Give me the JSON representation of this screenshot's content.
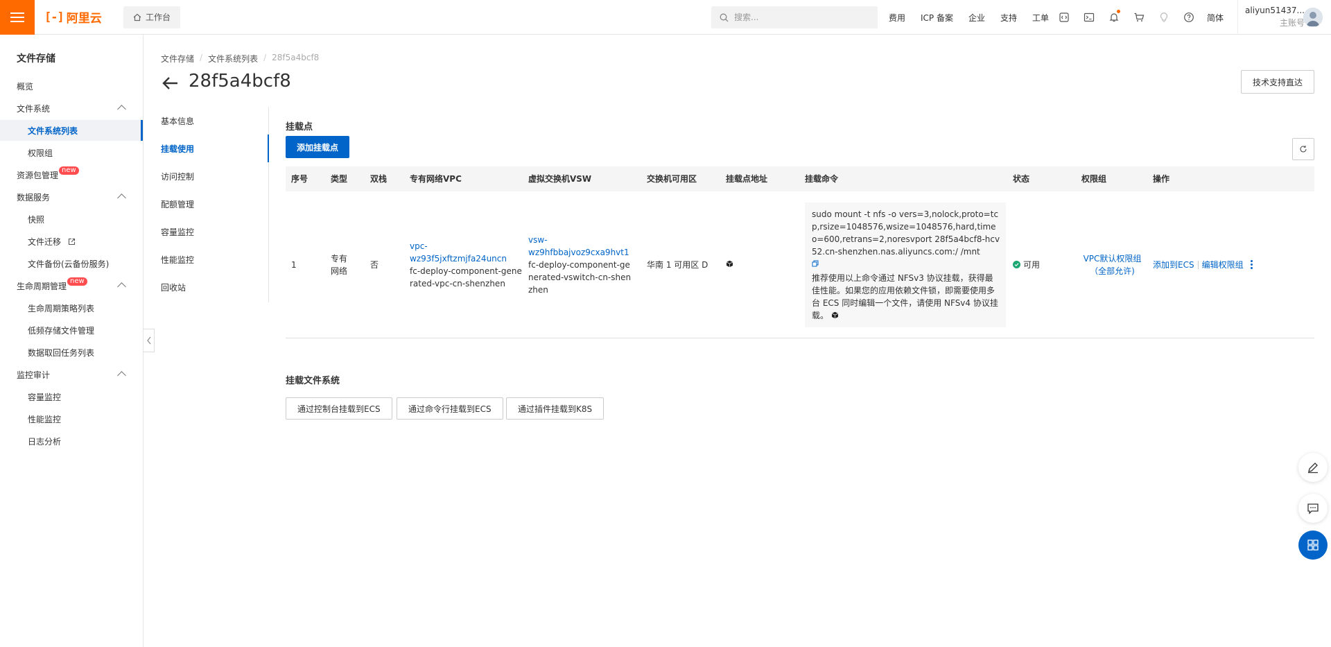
{
  "topbar": {
    "logo_text": "阿里云",
    "logo_mark": "[-]",
    "workbench": "工作台",
    "search_placeholder": "搜索...",
    "links": [
      "费用",
      "ICP 备案",
      "企业",
      "支持",
      "工单"
    ],
    "icons": [
      "code-icon",
      "terminal-icon",
      "bell-icon",
      "cart-icon",
      "lightbulb-icon",
      "help-icon"
    ],
    "language": "简体",
    "account_name": "aliyun51437...",
    "account_role": "主账号"
  },
  "sidebar": {
    "title": "文件存储",
    "items": [
      {
        "label": "概览"
      },
      {
        "label": "文件系统"
      },
      {
        "label": "文件系统列表"
      },
      {
        "label": "权限组"
      },
      {
        "label": "资源包管理",
        "badge": "new"
      },
      {
        "label": "数据服务"
      },
      {
        "label": "快照"
      },
      {
        "label": "文件迁移"
      },
      {
        "label": "文件备份(云备份服务)"
      },
      {
        "label": "生命周期管理",
        "badge": "new"
      },
      {
        "label": "生命周期策略列表"
      },
      {
        "label": "低频存储文件管理"
      },
      {
        "label": "数据取回任务列表"
      },
      {
        "label": "监控审计"
      },
      {
        "label": "容量监控"
      },
      {
        "label": "性能监控"
      },
      {
        "label": "日志分析"
      }
    ]
  },
  "breadcrumb": [
    "文件存储",
    "文件系统列表",
    "28f5a4bcf8"
  ],
  "page": {
    "title": "28f5a4bcf8",
    "support_button": "技术支持直达"
  },
  "subnav": [
    "基本信息",
    "挂载使用",
    "访问控制",
    "配额管理",
    "容量监控",
    "性能监控",
    "回收站"
  ],
  "mount_points": {
    "title": "挂载点",
    "add_button": "添加挂载点",
    "columns": [
      "序号",
      "类型",
      "双栈",
      "专有网络VPC",
      "虚拟交换机VSW",
      "交换机可用区",
      "挂载点地址",
      "挂载命令",
      "状态",
      "权限组",
      "操作"
    ],
    "row": {
      "index": "1",
      "type": "专有网络",
      "dual_stack": "否",
      "vpc_id": "vpc-wz93f5jxftzmjfa24uncn",
      "vpc_name": "fc-deploy-component-generated-vpc-cn-shenzhen",
      "vsw_id": "vsw-wz9hfbbajvoz9cxa9hvt1",
      "vsw_name": "fc-deploy-component-generated-vswitch-cn-shenzhen",
      "zone": "华南 1 可用区 D",
      "command": "sudo mount -t nfs -o vers=3,nolock,proto=tcp,rsize=1048576,wsize=1048576,hard,timeo=600,retrans=2,noresvport 28f5a4bcf8-hcv52.cn-shenzhen.nas.aliyuncs.com:/ /mnt",
      "command_tip": "推荐使用以上命令通过 NFSv3 协议挂载，获得最佳性能。如果您的应用依赖文件锁，即需要使用多台 ECS 同时编辑一个文件，请使用 NFSv4 协议挂载。",
      "status": "可用",
      "permission_group": "VPC默认权限组（全部允许)",
      "op_add_ecs": "添加到ECS",
      "op_edit_group": "编辑权限组"
    }
  },
  "mount_fs": {
    "title": "挂载文件系统",
    "buttons": [
      "通过控制台挂载到ECS",
      "通过命令行挂载到ECS",
      "通过插件挂载到K8S"
    ]
  },
  "colors": {
    "brand": "#ff6a00",
    "primary": "#0064c8",
    "success": "#1ba672"
  }
}
